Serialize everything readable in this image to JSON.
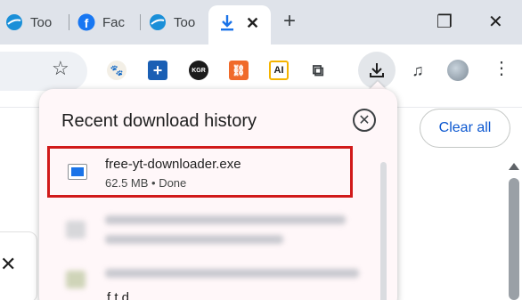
{
  "tabs": [
    {
      "label": "Too",
      "icon": "globe-icon"
    },
    {
      "label": "Fac",
      "icon": "facebook-icon"
    },
    {
      "label": "Too",
      "icon": "globe-icon"
    }
  ],
  "active_tab": {
    "icon": "download-icon",
    "close": "✕"
  },
  "new_tab_glyph": "+",
  "window_controls": {
    "restore": "❐",
    "close": "✕"
  },
  "toolbar": {
    "star": "☆",
    "extensions": [
      {
        "name": "extension-animal-icon",
        "text": "🐾"
      },
      {
        "name": "extension-plus-icon",
        "text": "+"
      },
      {
        "name": "extension-kgr-icon",
        "text": "KGR"
      },
      {
        "name": "extension-link-icon",
        "text": "⛓"
      },
      {
        "name": "extension-ai-icon",
        "text": "AI"
      },
      {
        "name": "extension-puzzle-icon",
        "text": "⧉"
      },
      {
        "name": "media-control-icon",
        "text": "♫"
      }
    ],
    "menu": "⋮"
  },
  "downloads": {
    "title": "Recent download history",
    "close": "✕",
    "clear_all": "Clear all",
    "items": [
      {
        "filename": "free-yt-downloader.exe",
        "status": "62.5 MB • Done"
      }
    ],
    "partial_text": "f  t      d     "
  },
  "colors": {
    "accent": "#0b57d0",
    "highlight": "#d11a1a",
    "file_blue": "#1a73e8"
  }
}
